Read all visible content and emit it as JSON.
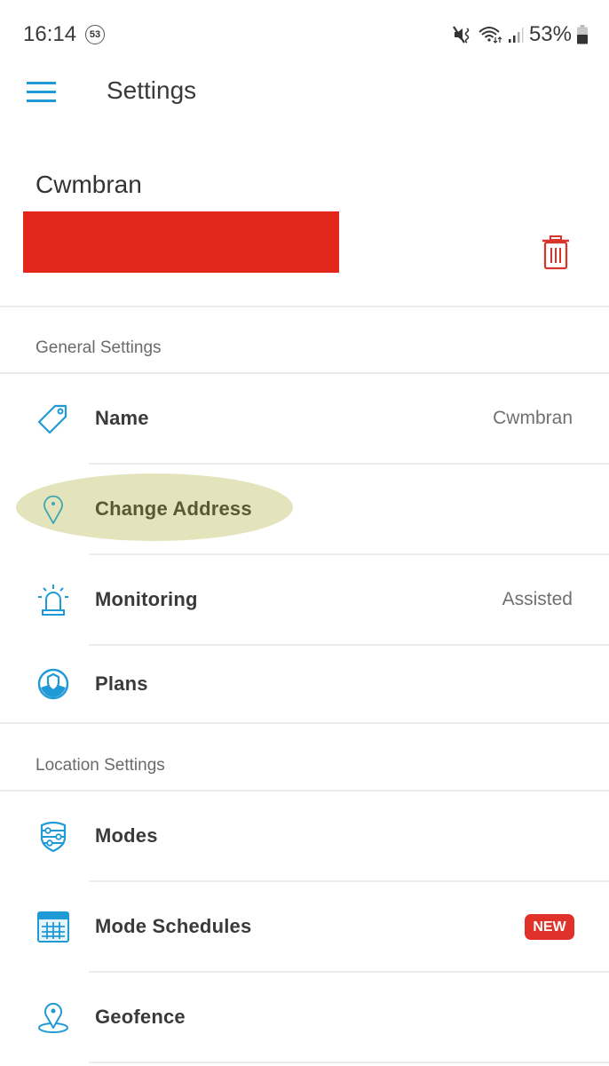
{
  "status_bar": {
    "time": "16:14",
    "notification_count": "53",
    "battery_percent": "53%",
    "icons": [
      "mute-vibrate-icon",
      "wifi-icon",
      "signal-icon",
      "battery-icon"
    ]
  },
  "app_bar": {
    "title": "Settings",
    "menu_icon": "hamburger-menu-icon"
  },
  "location": {
    "name": "Cwmbran",
    "address_redacted": true,
    "delete_icon": "trash-icon"
  },
  "sections": [
    {
      "title": "General Settings",
      "items": [
        {
          "label": "Name",
          "value": "Cwmbran",
          "icon": "tag-icon"
        },
        {
          "label": "Change Address",
          "value": "",
          "icon": "location-pin-icon",
          "highlighted": true
        },
        {
          "label": "Monitoring",
          "value": "Assisted",
          "icon": "siren-icon"
        },
        {
          "label": "Plans",
          "value": "",
          "icon": "plans-shield-icon"
        }
      ]
    },
    {
      "title": "Location Settings",
      "items": [
        {
          "label": "Modes",
          "value": "",
          "icon": "modes-shield-icon"
        },
        {
          "label": "Mode Schedules",
          "value": "",
          "icon": "calendar-icon",
          "badge": "NEW"
        },
        {
          "label": "Geofence",
          "value": "",
          "icon": "geofence-icon"
        }
      ]
    }
  ],
  "colors": {
    "accent": "#1f9ad6",
    "danger": "#e0322a",
    "highlight": "#e3e4bc",
    "redaction": "#e3261a"
  }
}
